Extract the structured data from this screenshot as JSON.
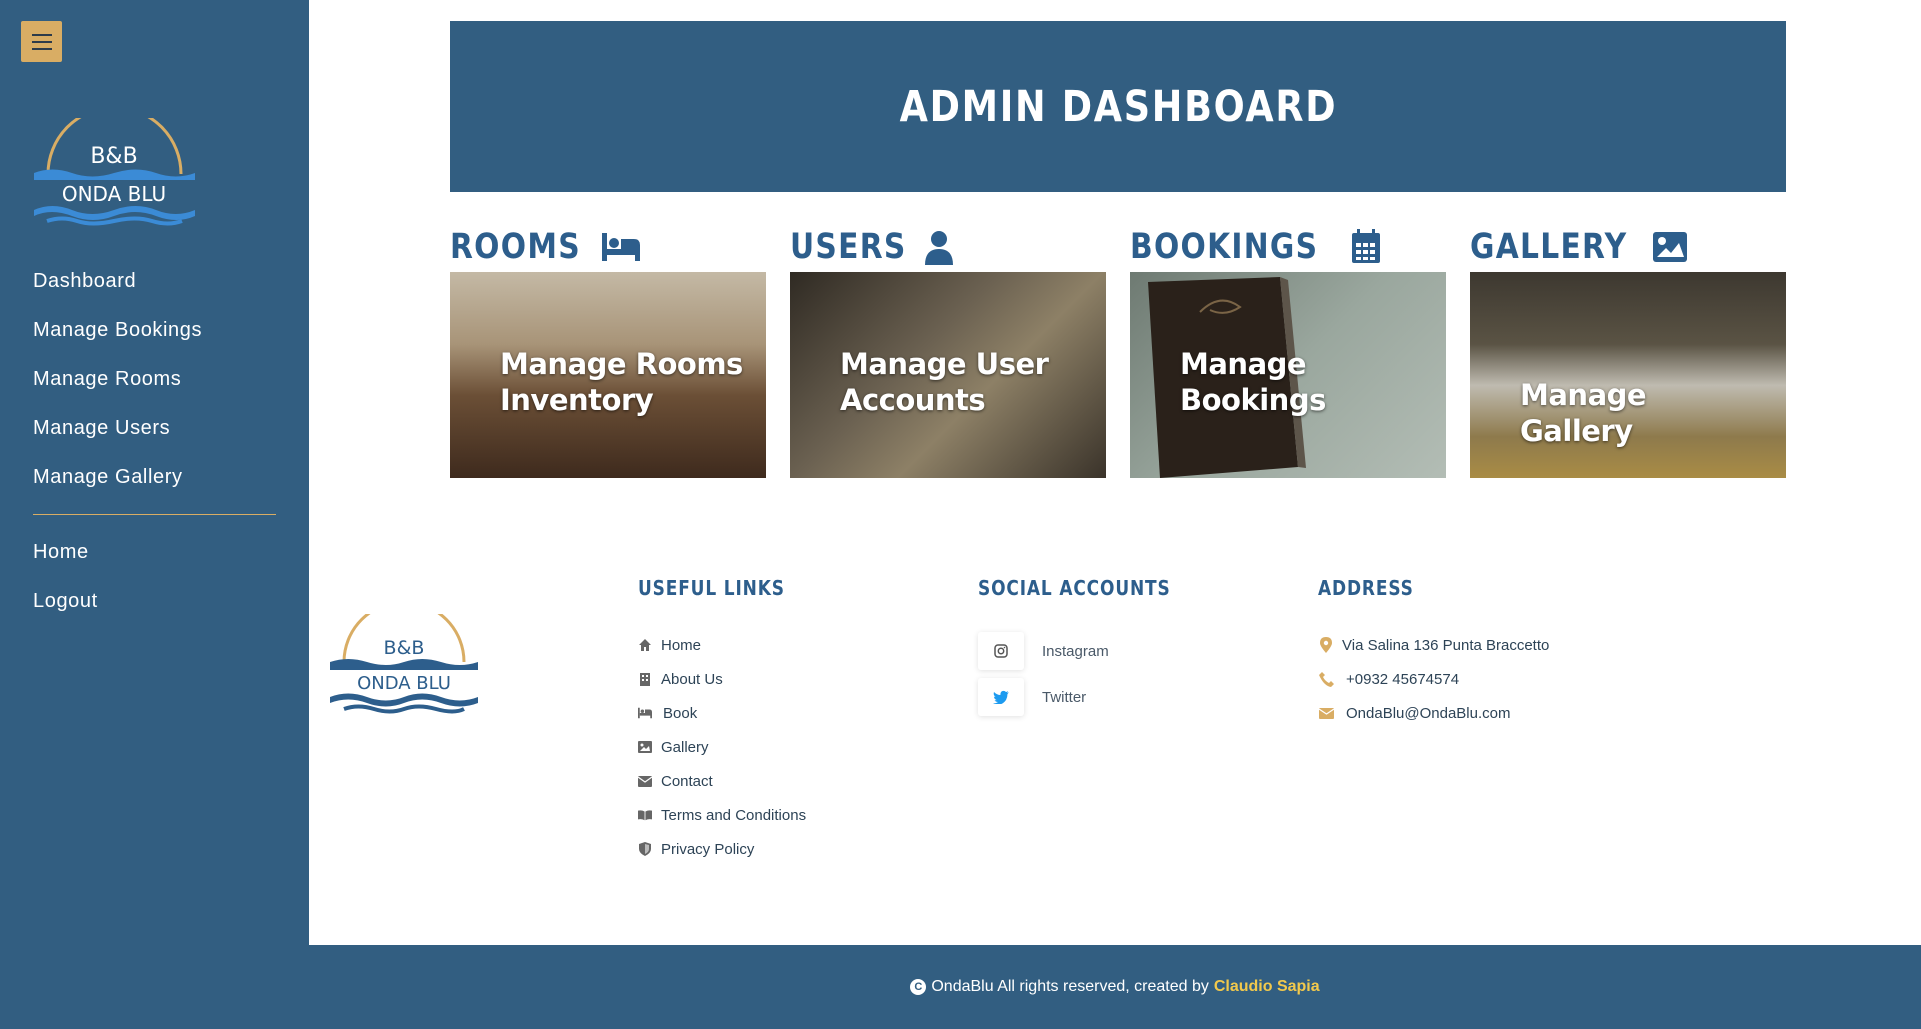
{
  "sidebar": {
    "logo": {
      "line1": "B&B",
      "line2": "ONDA BLU"
    },
    "nav": [
      "Dashboard",
      "Manage Bookings",
      "Manage Rooms",
      "Manage Users",
      "Manage Gallery"
    ],
    "nav2": [
      "Home",
      "Logout"
    ]
  },
  "header": {
    "title": "ADMIN DASHBOARD"
  },
  "cards": [
    {
      "title": "ROOMS",
      "icon": "bed-icon",
      "label": "Manage Rooms Inventory"
    },
    {
      "title": "USERS",
      "icon": "user-icon",
      "label": "Manage User Accounts"
    },
    {
      "title": "BOOKINGS",
      "icon": "calendar-icon",
      "label": "Manage Bookings"
    },
    {
      "title": "GALLERY",
      "icon": "image-icon",
      "label": "Manage Gallery"
    }
  ],
  "footer": {
    "logo": {
      "line1": "B&B",
      "line2": "ONDA BLU"
    },
    "useful_links": {
      "heading": "USEFUL LINKS",
      "items": [
        "Home",
        "About Us",
        "Book",
        "Gallery",
        "Contact",
        "Terms and Conditions",
        "Privacy Policy"
      ]
    },
    "social": {
      "heading": "SOCIAL ACCOUNTS",
      "items": [
        "Instagram",
        "Twitter"
      ]
    },
    "address": {
      "heading": "ADDRESS",
      "street": "Via Salina 136 Punta Braccetto",
      "phone": "+0932 45674574",
      "email": "OndaBlu@OndaBlu.com"
    },
    "copyright": {
      "text": "OndaBlu All rights reserved, created by",
      "author": "Claudio Sapia"
    }
  },
  "colors": {
    "primary": "#325e81",
    "accent": "#d9ad64",
    "heading": "#2d5e8c",
    "author": "#f2c94c"
  }
}
